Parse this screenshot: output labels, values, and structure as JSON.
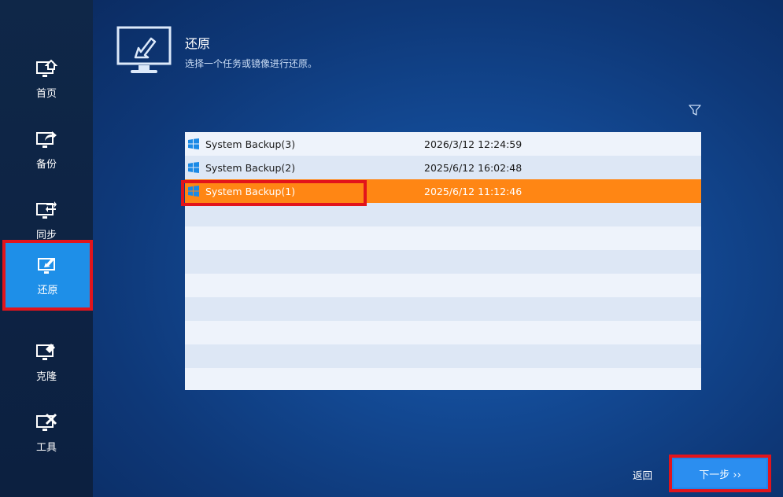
{
  "sidebar": {
    "items": [
      {
        "label": "首页",
        "icon": "monitor-home-icon"
      },
      {
        "label": "备份",
        "icon": "monitor-backup-icon"
      },
      {
        "label": "同步",
        "icon": "monitor-sync-icon"
      },
      {
        "label": "还原",
        "icon": "monitor-restore-icon",
        "active": true
      },
      {
        "label": "克隆",
        "icon": "monitor-clone-icon"
      },
      {
        "label": "工具",
        "icon": "monitor-tools-icon"
      }
    ]
  },
  "header": {
    "title": "还原",
    "subtitle": "选择一个任务或镜像进行还原。"
  },
  "backups": [
    {
      "name": "System Backup(3)",
      "time": "2026/3/12 12:24:59"
    },
    {
      "name": "System Backup(2)",
      "time": "2025/6/12 16:02:48"
    },
    {
      "name": "System Backup(1)",
      "time": "2025/6/12 11:12:46",
      "selected": true
    }
  ],
  "footer": {
    "back_label": "返回",
    "next_label": "下一步 ››"
  },
  "colors": {
    "accent": "#1e8fe8",
    "selected_row": "#ff8614",
    "highlight_outline": "#e2141b"
  }
}
